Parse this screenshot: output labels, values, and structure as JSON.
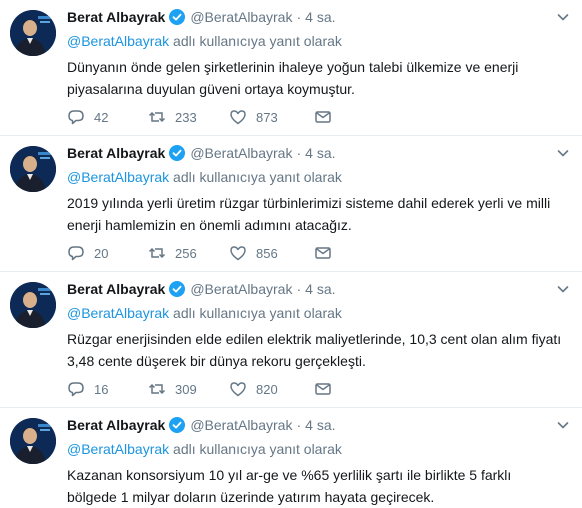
{
  "tweets": [
    {
      "author_name": "Berat Albayrak",
      "handle": "@BeratAlbayrak",
      "separator": "·",
      "time": "4 sa.",
      "reply_mention": "@BeratAlbayrak",
      "reply_suffix": " adlı kullanıcıya yanıt olarak",
      "text": "Dünyanın önde gelen şirketlerinin ihaleye yoğun talebi ülkemize ve enerji piyasalarına duyulan güveni ortaya koymuştur.",
      "replies": "42",
      "retweets": "233",
      "likes": "873"
    },
    {
      "author_name": "Berat Albayrak",
      "handle": "@BeratAlbayrak",
      "separator": "·",
      "time": "4 sa.",
      "reply_mention": "@BeratAlbayrak",
      "reply_suffix": " adlı kullanıcıya yanıt olarak",
      "text": "2019 yılında yerli üretim rüzgar türbinlerimizi sisteme dahil ederek yerli ve milli enerji hamlemizin en önemli adımını atacağız.",
      "replies": "20",
      "retweets": "256",
      "likes": "856"
    },
    {
      "author_name": "Berat Albayrak",
      "handle": "@BeratAlbayrak",
      "separator": "·",
      "time": "4 sa.",
      "reply_mention": "@BeratAlbayrak",
      "reply_suffix": " adlı kullanıcıya yanıt olarak",
      "text": "Rüzgar enerjisinden elde edilen elektrik maliyetlerinde, 10,3 cent olan alım fiyatı 3,48 cente düşerek bir dünya rekoru gerçekleşti.",
      "replies": "16",
      "retweets": "309",
      "likes": "820"
    },
    {
      "author_name": "Berat Albayrak",
      "handle": "@BeratAlbayrak",
      "separator": "·",
      "time": "4 sa.",
      "reply_mention": "@BeratAlbayrak",
      "reply_suffix": " adlı kullanıcıya yanıt olarak",
      "text": "Kazanan konsorsiyum 10 yıl ar-ge ve %65 yerlilik şartı ile birlikte 5 farklı bölgede 1 milyar doların üzerinde yatırım hayata geçirecek.",
      "replies": "",
      "retweets": "",
      "likes": ""
    }
  ],
  "icons": {
    "verified": "verified-badge-icon",
    "caret": "chevron-down-icon",
    "reply": "reply-icon",
    "retweet": "retweet-icon",
    "like": "heart-icon",
    "message": "envelope-icon"
  },
  "colors": {
    "verified": "#1da1f2",
    "mention": "#1b95e0",
    "muted": "#657786",
    "text": "#14171a",
    "divider": "#e6ecf0"
  }
}
